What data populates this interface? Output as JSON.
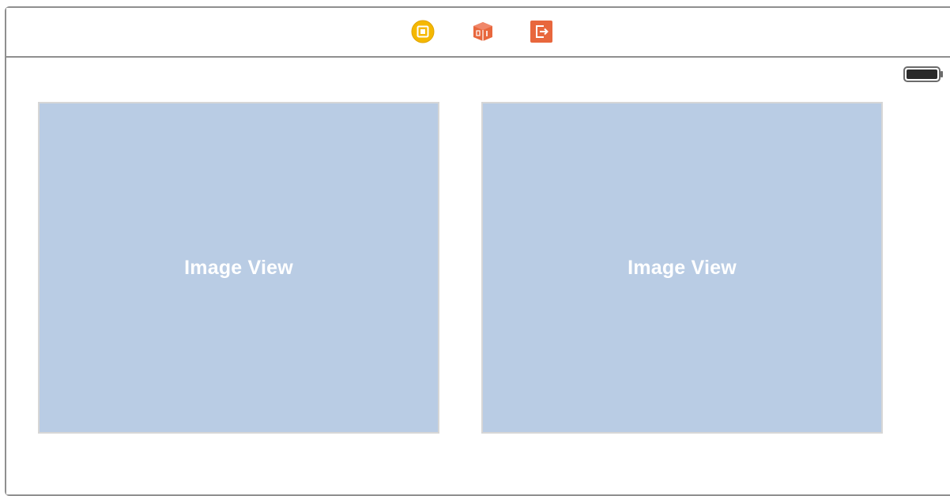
{
  "scene_dock": {
    "icons": [
      {
        "name": "view-controller-icon",
        "color": "#f5b800"
      },
      {
        "name": "first-responder-icon",
        "color": "#e8673d"
      },
      {
        "name": "exit-icon",
        "color": "#e8673d"
      }
    ]
  },
  "status_bar": {
    "battery_icon": "battery-icon"
  },
  "views": [
    {
      "label": "Image View",
      "background": "#b9cce4"
    },
    {
      "label": "Image View",
      "background": "#b9cce4"
    }
  ]
}
